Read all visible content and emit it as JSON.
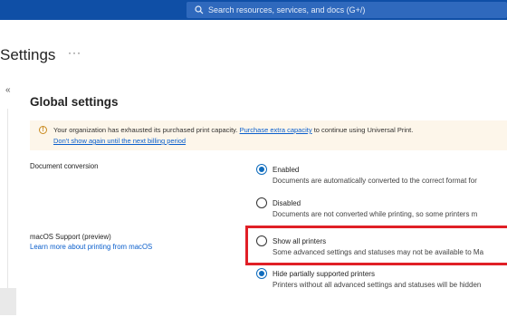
{
  "search": {
    "placeholder": "Search resources, services, and docs (G+/)"
  },
  "page": {
    "title": "Settings",
    "more": "···",
    "collapse": "«"
  },
  "section": {
    "title": "Global settings"
  },
  "banner": {
    "text_before": "Your organization has exhausted its purchased print capacity.",
    "link": "Purchase extra capacity",
    "text_after": "to continue using Universal Print.",
    "dismiss": "Don't show again until the next billing period"
  },
  "document_conversion": {
    "label": "Document conversion",
    "options": [
      {
        "title": "Enabled",
        "desc": "Documents are automatically converted to the correct format for",
        "checked": true
      },
      {
        "title": "Disabled",
        "desc": "Documents are not converted while printing, so some printers m",
        "checked": false
      }
    ]
  },
  "macos": {
    "label": "macOS Support (preview)",
    "link": "Learn more about printing from macOS",
    "options": [
      {
        "title": "Show all printers",
        "desc": "Some advanced settings and statuses may not be available to Ma",
        "checked": false
      },
      {
        "title": "Hide partially supported printers",
        "desc": "Printers without all advanced settings and statuses will be hidden",
        "checked": true
      }
    ]
  },
  "colors": {
    "topbar": "#0f4fa6",
    "accent": "#0f6cbd",
    "highlight": "#e01f26",
    "banner_bg": "#fdf6ea"
  }
}
